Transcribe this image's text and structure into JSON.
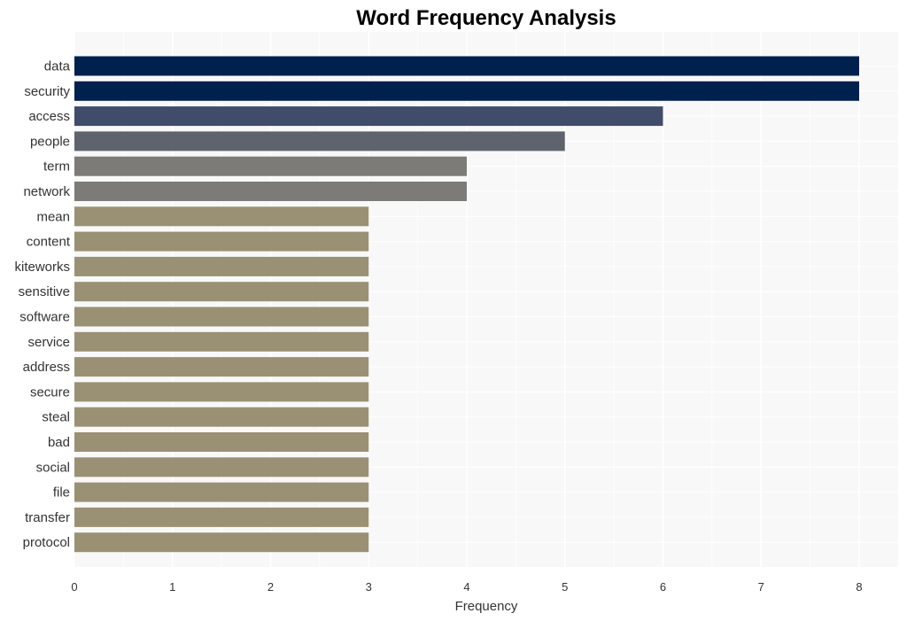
{
  "chart_data": {
    "type": "bar",
    "orientation": "horizontal",
    "title": "Word Frequency Analysis",
    "xlabel": "Frequency",
    "ylabel": "",
    "xlim": [
      0,
      8.4
    ],
    "x_ticks": [
      0,
      1,
      2,
      3,
      4,
      5,
      6,
      7,
      8
    ],
    "grid": true,
    "legend": "none",
    "categories": [
      "data",
      "security",
      "access",
      "people",
      "term",
      "network",
      "mean",
      "content",
      "kiteworks",
      "sensitive",
      "software",
      "service",
      "address",
      "secure",
      "steal",
      "bad",
      "social",
      "file",
      "transfer",
      "protocol"
    ],
    "values": [
      8,
      8,
      6,
      5,
      4,
      4,
      3,
      3,
      3,
      3,
      3,
      3,
      3,
      3,
      3,
      3,
      3,
      3,
      3,
      3
    ],
    "colors": {
      "8": "#00204e",
      "6": "#414c6b",
      "5": "#5f636e",
      "4": "#7c7b78",
      "3": "#9a9174"
    },
    "plot_background": "#f8f8f8",
    "grid_color": "#ffffff"
  }
}
